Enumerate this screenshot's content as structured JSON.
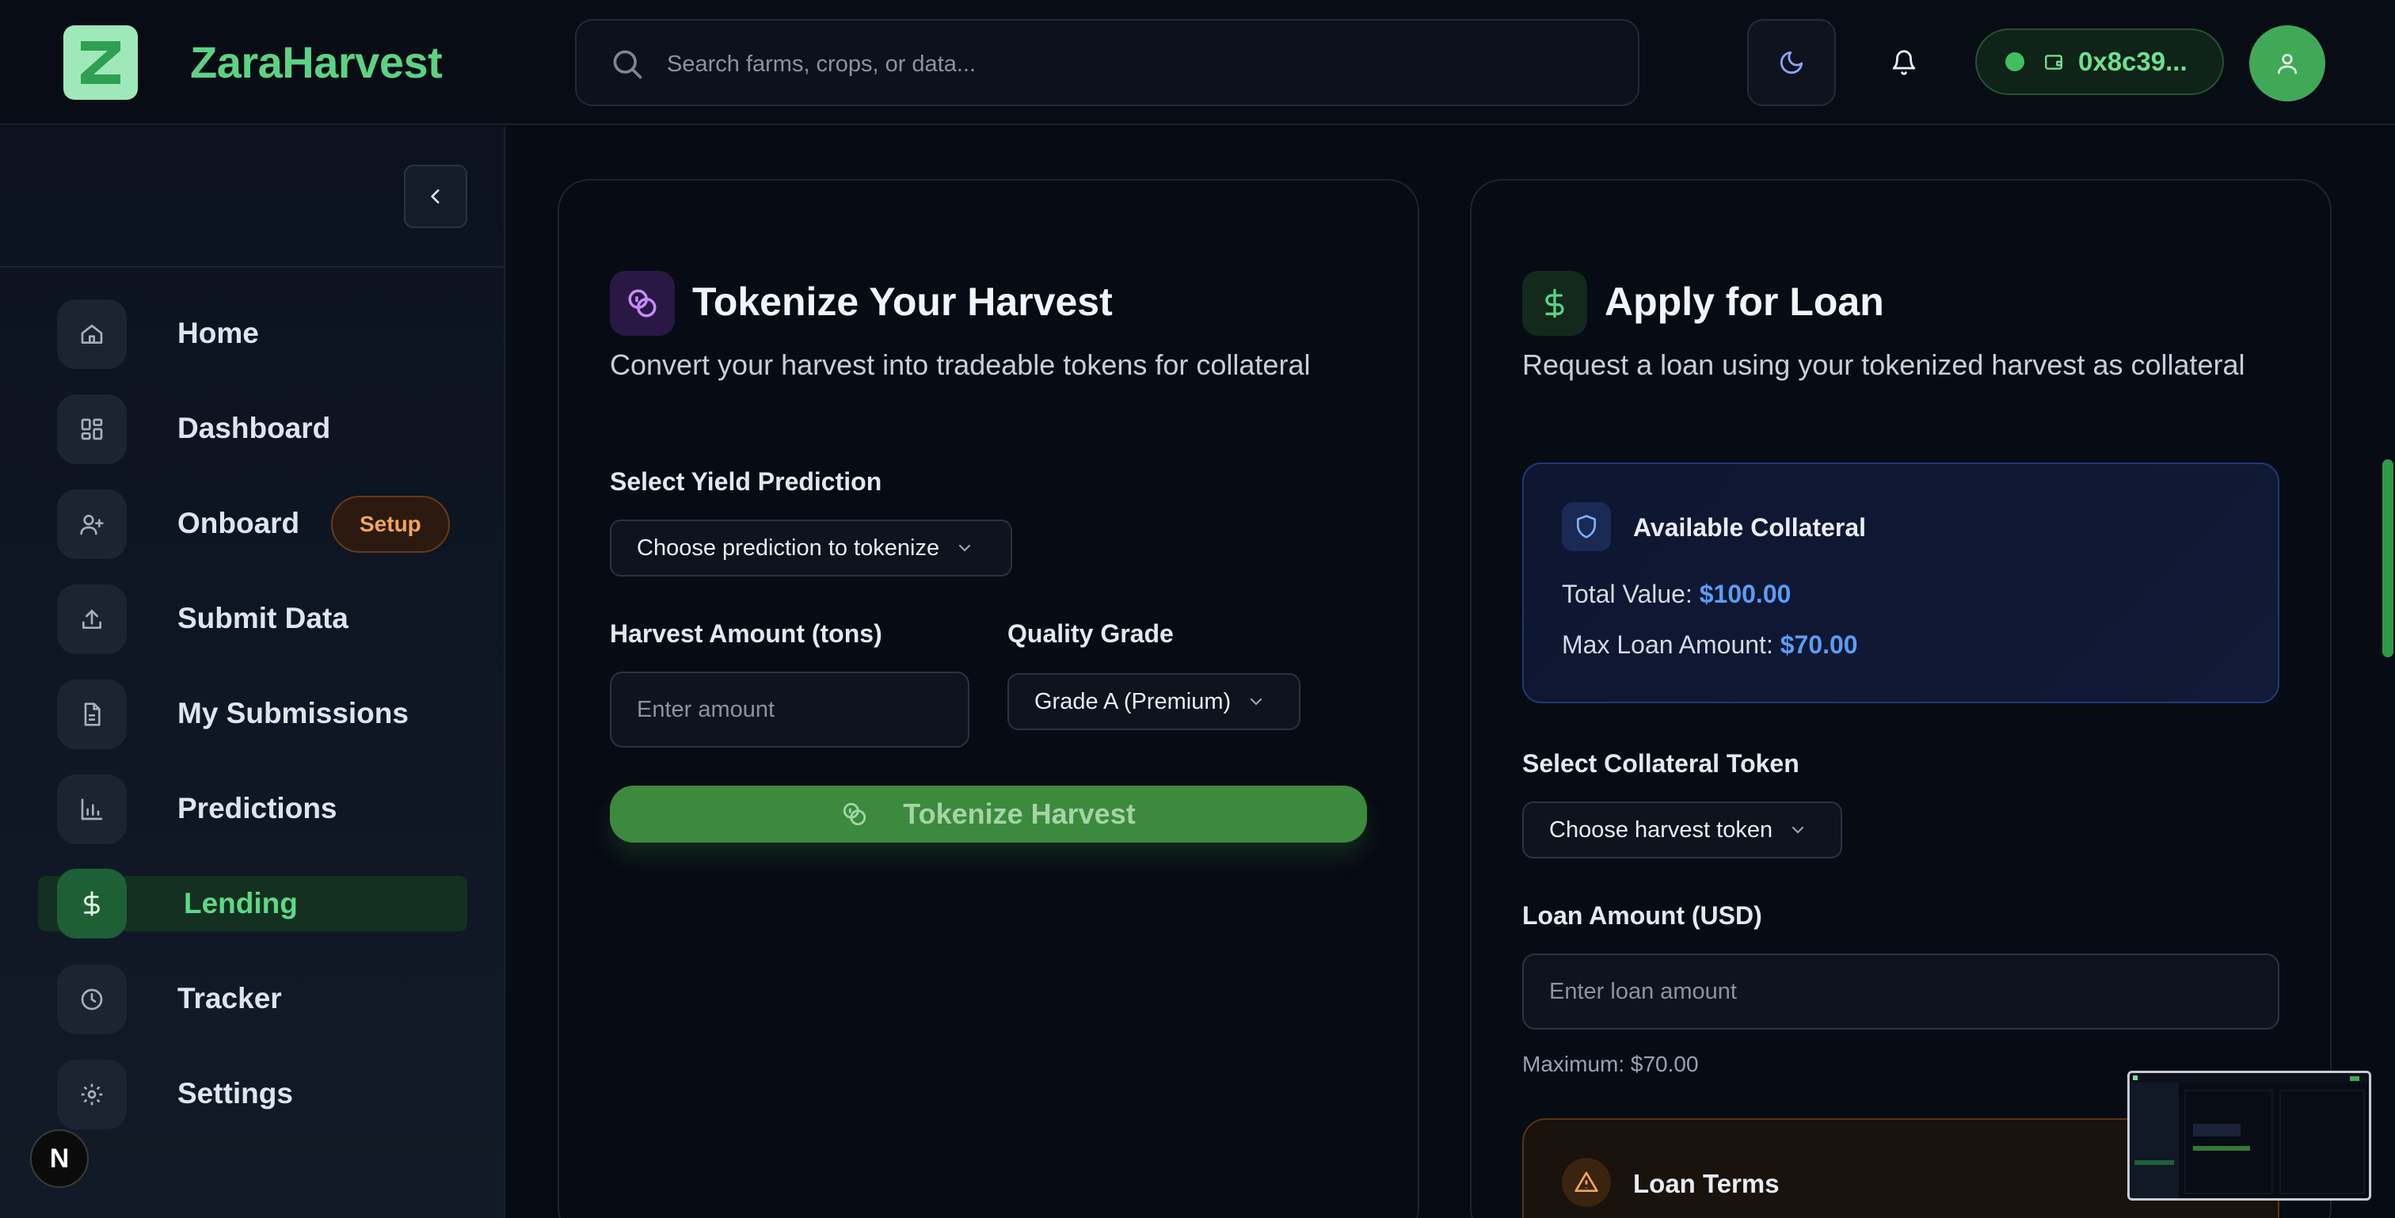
{
  "header": {
    "brand": "ZaraHarvest",
    "search_placeholder": "Search farms, crops, or data...",
    "wallet_address": "0x8c39..."
  },
  "sidebar": {
    "items": [
      {
        "label": "Home",
        "icon": "home-icon"
      },
      {
        "label": "Dashboard",
        "icon": "dashboard-icon"
      },
      {
        "label": "Onboard",
        "icon": "user-plus-icon",
        "badge": "Setup"
      },
      {
        "label": "Submit Data",
        "icon": "upload-icon"
      },
      {
        "label": "My Submissions",
        "icon": "file-text-icon"
      },
      {
        "label": "Predictions",
        "icon": "bar-chart-icon"
      },
      {
        "label": "Lending",
        "icon": "dollar-icon",
        "active": true
      },
      {
        "label": "Tracker",
        "icon": "clock-icon"
      },
      {
        "label": "Settings",
        "icon": "gear-icon"
      }
    ],
    "dev_badge": "N"
  },
  "tokenize": {
    "title": "Tokenize Your Harvest",
    "subtitle": "Convert your harvest into tradeable tokens for collateral",
    "yield_label": "Select Yield Prediction",
    "yield_placeholder": "Choose prediction to tokenize",
    "amount_label": "Harvest Amount (tons)",
    "amount_placeholder": "Enter amount",
    "grade_label": "Quality Grade",
    "grade_value": "Grade A (Premium)",
    "button": "Tokenize Harvest"
  },
  "loan": {
    "title": "Apply for Loan",
    "subtitle": "Request a loan using your tokenized harvest as collateral",
    "collateral": {
      "title": "Available Collateral",
      "total_label": "Total Value:",
      "total_value": "$100.00",
      "max_label": "Max Loan Amount:",
      "max_value": "$70.00"
    },
    "token_label": "Select Collateral Token",
    "token_placeholder": "Choose harvest token",
    "amount_label": "Loan Amount (USD)",
    "amount_placeholder": "Enter loan amount",
    "max_hint": "Maximum: $70.00",
    "terms_title": "Loan Terms"
  },
  "colors": {
    "brand_green": "#5bd282",
    "accent_blue": "#5b9cf5",
    "warning_orange": "#f0a65c"
  }
}
